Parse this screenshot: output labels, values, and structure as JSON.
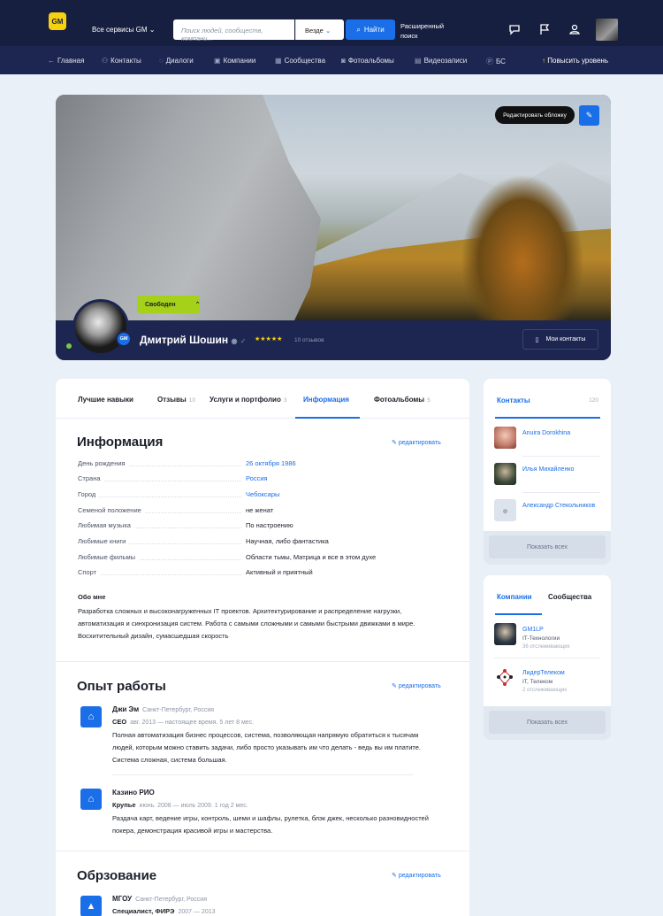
{
  "header": {
    "logo": "GM",
    "services": "Все сервисы GM",
    "search_placeholder": "Поиск людей, сообществ, компани...",
    "where": "Везде",
    "find": "Найти",
    "advanced": "Расширенный поиск"
  },
  "nav": {
    "items": [
      "Главная",
      "Контакты",
      "Диалоги",
      "Компании",
      "Сообщества",
      "Фотоальбомы",
      "Видеозаписи",
      "БС"
    ],
    "upgrade": "Повысить уровень"
  },
  "profile": {
    "edit_cover_tooltip": "Редактировать обложку",
    "status": "Свободен",
    "badge": "GM",
    "name": "Дмитрий Шошин",
    "stars": "★★★★★",
    "reviews": "10 отзывов",
    "my_contacts": "Мои контакты"
  },
  "tabs": [
    {
      "label": "Лучшие навыки",
      "count": ""
    },
    {
      "label": "Отзывы",
      "count": "10"
    },
    {
      "label": "Услуги и портфолио",
      "count": "3"
    },
    {
      "label": "Информация",
      "count": ""
    },
    {
      "label": "Фотоальбомы",
      "count": "5"
    }
  ],
  "info": {
    "title": "Информация",
    "edit": "редактировать",
    "rows": [
      {
        "k": "День рождения",
        "v": "26 октября 1986"
      },
      {
        "k": "Страна",
        "v": "Россия"
      },
      {
        "k": "Город",
        "v": "Чебоксары"
      },
      {
        "k": "Семеной положение",
        "v": "не женат"
      },
      {
        "k": "Любимая музыка",
        "v": "По настроению"
      },
      {
        "k": "Любимые книги",
        "v": "Научная, либо фантастика"
      },
      {
        "k": "Любимые фильмы",
        "v": "Области тьмы, Матрица и все в этом духе"
      },
      {
        "k": "Спорт",
        "v": "Активный и приятный"
      }
    ],
    "about_title": "Обо мне",
    "about": "Разработка сложных и высоконагруженных IT проектов. Архитектурирование и распределение нагрузки, автоматизация и синхронизация систем. Работа с самыми сложными и самыми быстрыми движками в мире. Восхитительный дизайн, сумасшедшая скорость"
  },
  "work": {
    "title": "Опыт работы",
    "edit": "редактировать",
    "jobs": [
      {
        "name": "Джи Эм",
        "place": "Санкт-Петербург, Россия",
        "role": "CEO",
        "period": "авг. 2013 — настоящее время. 5 лет 8 мес.",
        "desc": "Полная автоматизация бизнес процессов, система, позволяющая напрямую обратиться к тысячам людей, которым можно ставить задачи, либо просто указывать им что делать - ведь вы им платите. Система сложная, система большая."
      },
      {
        "name": "Казино РИО",
        "place": "",
        "role": "Крупье",
        "period": "июнь. 2008 — июль 2009. 1 год 2 мес.",
        "desc": "Раздача карт, ведение игры, контроль, шеми и шафлы, рулетка, блэк джек, несколько разновидностей покера, демонстрация красивой игры и мастерства."
      }
    ]
  },
  "education": {
    "title": "Обрзование",
    "edit": "редактировать",
    "name": "МГОУ",
    "place": "Санкт-Петербург, Россия",
    "role": "Специалист, ФИРЭ",
    "period": "2007 — 2013"
  },
  "contacts": {
    "title": "Контакты",
    "count": "120",
    "people": [
      "Anuira Dorokhina",
      "Илья Михайленко",
      "Александр Стекольников"
    ],
    "show_all": "Показать всех"
  },
  "companies": {
    "tab1": "Компании",
    "tab2": "Сообщества",
    "items": [
      {
        "name": "GM1LP",
        "sub": "IT-Технологии",
        "followers": "36 отслеживающих"
      },
      {
        "name": "ЛидерТелеком",
        "sub": "IT, Телеком",
        "followers": "2 отслеживающих"
      }
    ],
    "show_all": "Показать всех"
  },
  "colors": {
    "accent": "#1a6ee8",
    "header": "#171f40",
    "status": "#a6d11b"
  }
}
